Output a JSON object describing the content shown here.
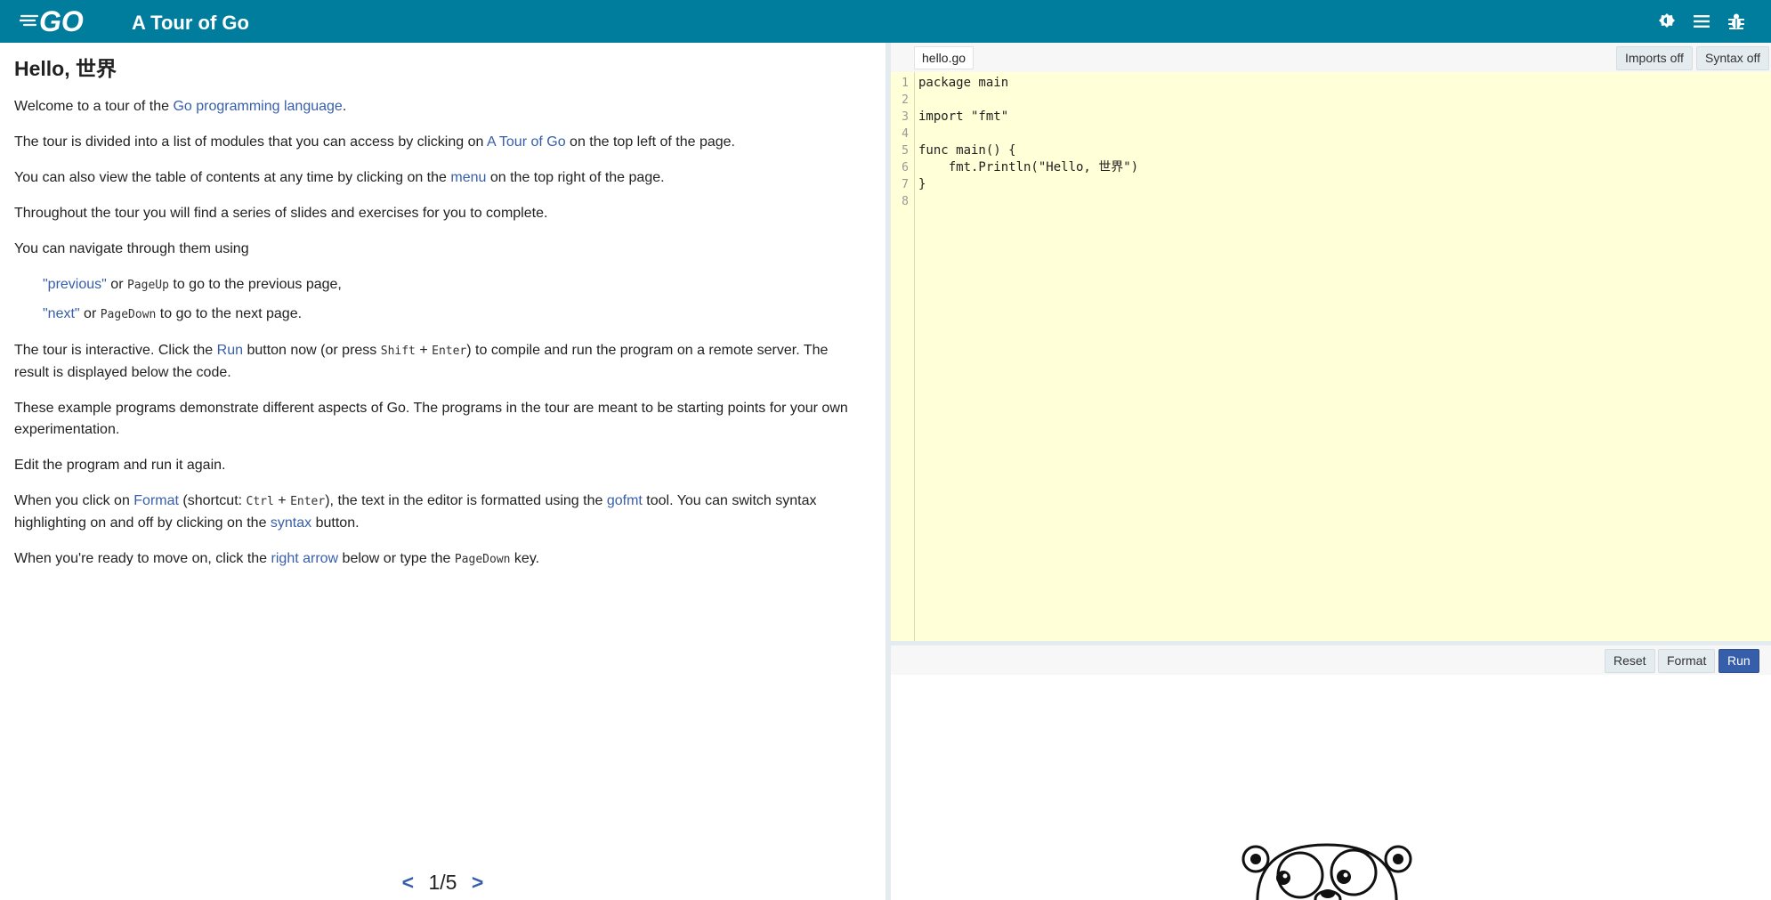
{
  "header": {
    "logo_label": "GO",
    "title": "A Tour of Go",
    "icons": [
      "theme-toggle-icon",
      "menu-icon",
      "bug-icon"
    ],
    "colors": {
      "bar": "#007d9c",
      "link": "#375eab",
      "editor_bg": "#ffffd8"
    }
  },
  "lesson": {
    "heading": "Hello, 世界",
    "p1": {
      "t1": "Welcome to a tour of the ",
      "link": "Go programming language",
      "t2": "."
    },
    "p2": {
      "t1": "The tour is divided into a list of modules that you can access by clicking on ",
      "link": "A Tour of Go",
      "t2": " on the top left of the page."
    },
    "p3": {
      "t1": "You can also view the table of contents at any time by clicking on the ",
      "link": "menu",
      "t2": " on the top right of the page."
    },
    "p4": "Throughout the tour you will find a series of slides and exercises for you to complete.",
    "p5": "You can navigate through them using",
    "nav_prev": {
      "link": "\"previous\"",
      "t1": " or ",
      "key": "PageUp",
      "t2": " to go to the previous page,"
    },
    "nav_next": {
      "link": "\"next\"",
      "t1": " or ",
      "key": "PageDown",
      "t2": " to go to the next page."
    },
    "p6": {
      "t1": "The tour is interactive. Click the ",
      "link": "Run",
      "t2": " button now (or press ",
      "k1": "Shift",
      "plus": " + ",
      "k2": "Enter",
      "t3": ") to compile and run the program on a remote server. The result is displayed below the code."
    },
    "p7": "These example programs demonstrate different aspects of Go. The programs in the tour are meant to be starting points for your own experimentation.",
    "p8": "Edit the program and run it again.",
    "p9": {
      "t1": "When you click on ",
      "link1": "Format",
      "t2": " (shortcut: ",
      "k1": "Ctrl",
      "plus": " + ",
      "k2": "Enter",
      "t3": "), the text in the editor is formatted using the ",
      "link2": "gofmt",
      "t4": " tool. You can switch syntax highlighting on and off by clicking on the ",
      "link3": "syntax",
      "t5": " button."
    },
    "p10": {
      "t1": "When you're ready to move on, click the ",
      "link": "right arrow",
      "t2": " below or type the ",
      "key": "PageDown",
      "t3": " key."
    }
  },
  "pager": {
    "prev": "<",
    "current": "1/5",
    "next": ">"
  },
  "editor": {
    "file_tab": "hello.go",
    "imports_btn": "Imports off",
    "syntax_btn": "Syntax off",
    "line_numbers": [
      "1",
      "2",
      "3",
      "4",
      "5",
      "6",
      "7",
      "8"
    ],
    "lines": [
      "package main",
      "",
      "import \"fmt\"",
      "",
      "func main() {",
      "    fmt.Println(\"Hello, 世界\")",
      "}",
      ""
    ]
  },
  "actions": {
    "reset": "Reset",
    "format": "Format",
    "run": "Run"
  }
}
